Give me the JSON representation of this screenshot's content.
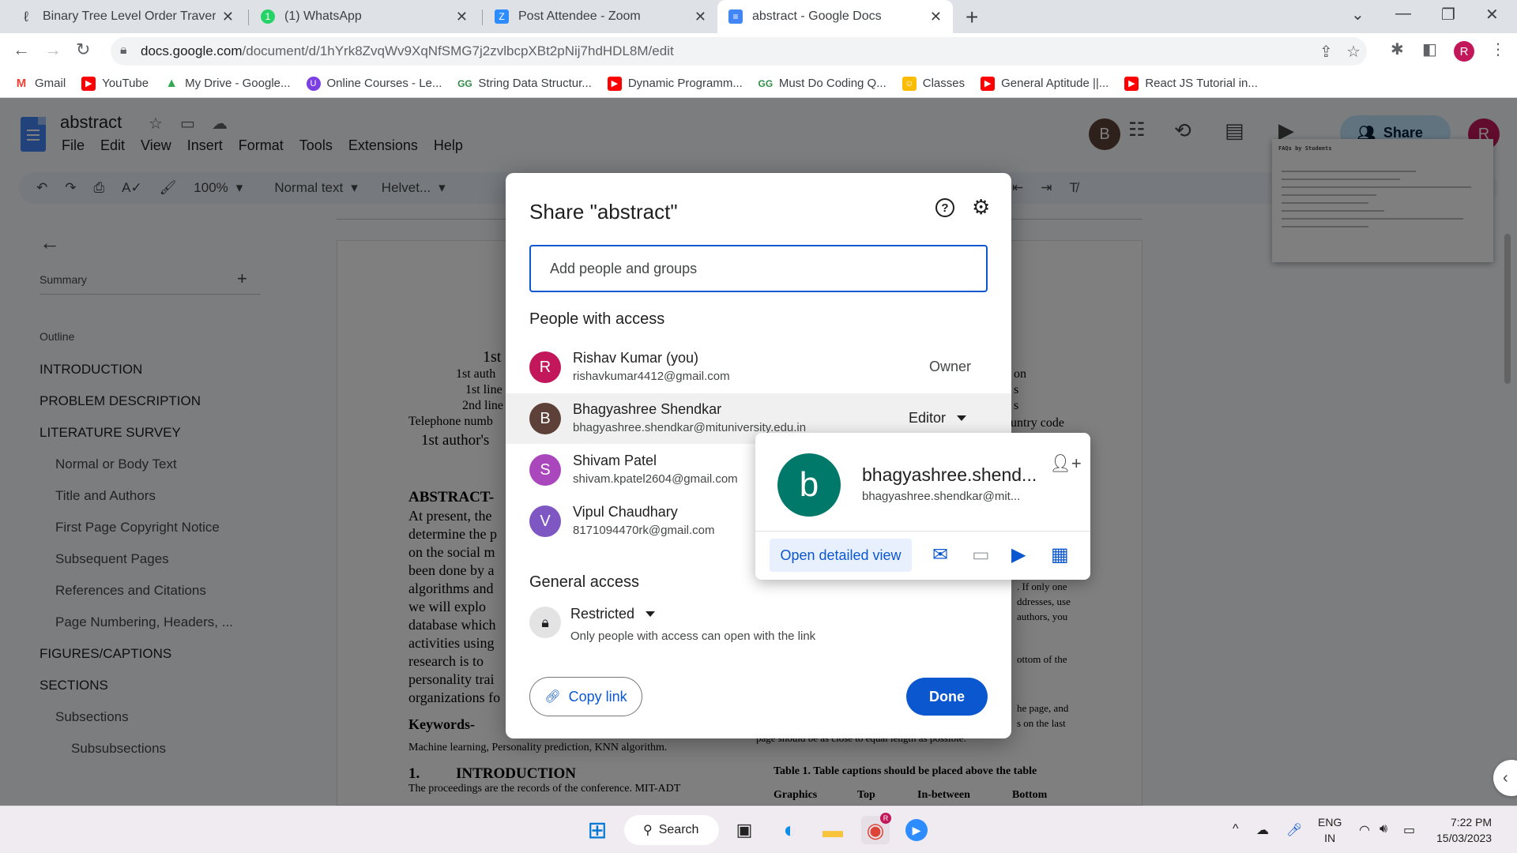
{
  "browser": {
    "tabs": [
      {
        "title": "Binary Tree Level Order Traversal",
        "icon": "leetcode-icon",
        "color": "#ffa116"
      },
      {
        "title": "(1) WhatsApp",
        "icon": "whatsapp-icon",
        "color": "#25d366"
      },
      {
        "title": "Post Attendee - Zoom",
        "icon": "zoom-icon",
        "color": "#2d8cff"
      },
      {
        "title": "abstract - Google Docs",
        "icon": "docs-icon",
        "color": "#4285f4"
      }
    ],
    "url_domain": "docs.google.com",
    "url_path": "/document/d/1hYrk8ZvqWv9XqNfSMG7j2zvlbcpXBt2pNij7hdHDL8M/edit",
    "profile_initial": "R",
    "bookmarks": [
      {
        "label": "Gmail",
        "color": "#ea4335"
      },
      {
        "label": "YouTube",
        "color": "#ff0000"
      },
      {
        "label": "My Drive - Google...",
        "color": "#34a853"
      },
      {
        "label": "Online Courses - Le...",
        "color": "#7b3fe4"
      },
      {
        "label": "String Data Structur...",
        "color": "#2f8d46"
      },
      {
        "label": "Dynamic Programm...",
        "color": "#ff0000"
      },
      {
        "label": "Must Do Coding Q...",
        "color": "#2f8d46"
      },
      {
        "label": "Classes",
        "color": "#fbbc04"
      },
      {
        "label": "General Aptitude ||...",
        "color": "#ff0000"
      },
      {
        "label": "React JS Tutorial in...",
        "color": "#ff0000"
      }
    ]
  },
  "docs": {
    "title": "abstract",
    "menu": [
      "File",
      "Edit",
      "View",
      "Insert",
      "Format",
      "Tools",
      "Extensions",
      "Help"
    ],
    "zoom": "100%",
    "style": "Normal text",
    "font": "Helvet...",
    "share_label": "Share",
    "collaborator_initial": "B",
    "user_initial": "R",
    "outline": {
      "summary_label": "Summary",
      "outline_label": "Outline",
      "items": [
        {
          "text": "INTRODUCTION",
          "level": 1
        },
        {
          "text": "PROBLEM DESCRIPTION",
          "level": 1
        },
        {
          "text": "LITERATURE SURVEY",
          "level": 1
        },
        {
          "text": "Normal or Body Text",
          "level": 2
        },
        {
          "text": "Title and Authors",
          "level": 2
        },
        {
          "text": "First Page Copyright Notice",
          "level": 2
        },
        {
          "text": "Subsequent Pages",
          "level": 2
        },
        {
          "text": "References and Citations",
          "level": 2
        },
        {
          "text": "Page Numbering, Headers, ...",
          "level": 2
        },
        {
          "text": "FIGURES/CAPTIONS",
          "level": 1
        },
        {
          "text": "SECTIONS",
          "level": 1
        },
        {
          "text": "Subsections",
          "level": 2
        },
        {
          "text": "Subsubsections",
          "level": 3
        }
      ]
    },
    "page": {
      "author_lines": [
        "1st",
        "1st auth",
        "1st line",
        "2nd line",
        "Telephone numb",
        "1st author's"
      ],
      "right_fragments": [
        "on",
        "s",
        "s",
        "untry code"
      ],
      "abstract_heading": "ABSTRACT-",
      "abstract_lines": [
        "At present, the",
        "determine the p",
        "on the social m",
        "been done by a",
        "algorithms and",
        "we will explo",
        "database which",
        "activities using",
        "research is to",
        "personality trai",
        "organizations fo"
      ],
      "right_lines": [
        ". If only one",
        "ddresses, use",
        "authors, you",
        "ottom of the",
        "he page, and",
        "s on the last"
      ],
      "right_tail": "page should be as close to equal length as possible.",
      "keywords_heading": "Keywords-",
      "keywords_text": "Machine learning, Personality prediction, KNN algorithm.",
      "intro_heading_num": "1.",
      "intro_heading": "INTRODUCTION",
      "intro_text": "The proceedings are the records of the conference. MIT-ADT",
      "table_caption": "Table 1. Table captions should be placed above the table",
      "table_headers": [
        "Graphics",
        "Top",
        "In-between",
        "Bottom"
      ]
    },
    "thumbnail_title": "FAQs by Students"
  },
  "share_dialog": {
    "title": "Share \"abstract\"",
    "input_placeholder": "Add people and groups",
    "people_heading": "People with access",
    "people": [
      {
        "name": "Rishav Kumar (you)",
        "email": "rishavkumar4412@gmail.com",
        "role": "Owner",
        "initial": "R",
        "color": "#c2185b"
      },
      {
        "name": "Bhagyashree Shendkar",
        "email": "bhagyashree.shendkar@mituniversity.edu.in",
        "role": "Editor",
        "initial": "B",
        "color": "#5d4037"
      },
      {
        "name": "Shivam Patel",
        "email": "shivam.kpatel2604@gmail.com",
        "role": "",
        "initial": "S",
        "color": "#ab47bc"
      },
      {
        "name": "Vipul Chaudhary",
        "email": "8171094470rk@gmail.com",
        "role": "",
        "initial": "V",
        "color": "#7e57c2"
      }
    ],
    "general_heading": "General access",
    "access_level": "Restricted",
    "access_desc": "Only people with access can open with the link",
    "copy_link": "Copy link",
    "done": "Done"
  },
  "hover_card": {
    "initial": "b",
    "name": "bhagyashree.shend...",
    "email": "bhagyashree.shendkar@mit...",
    "open_detail": "Open detailed view",
    "avatar_color": "#00796b"
  },
  "taskbar": {
    "search_label": "Search",
    "lang_line1": "ENG",
    "lang_line2": "IN",
    "time": "7:22 PM",
    "date": "15/03/2023",
    "chrome_badge": "R"
  }
}
